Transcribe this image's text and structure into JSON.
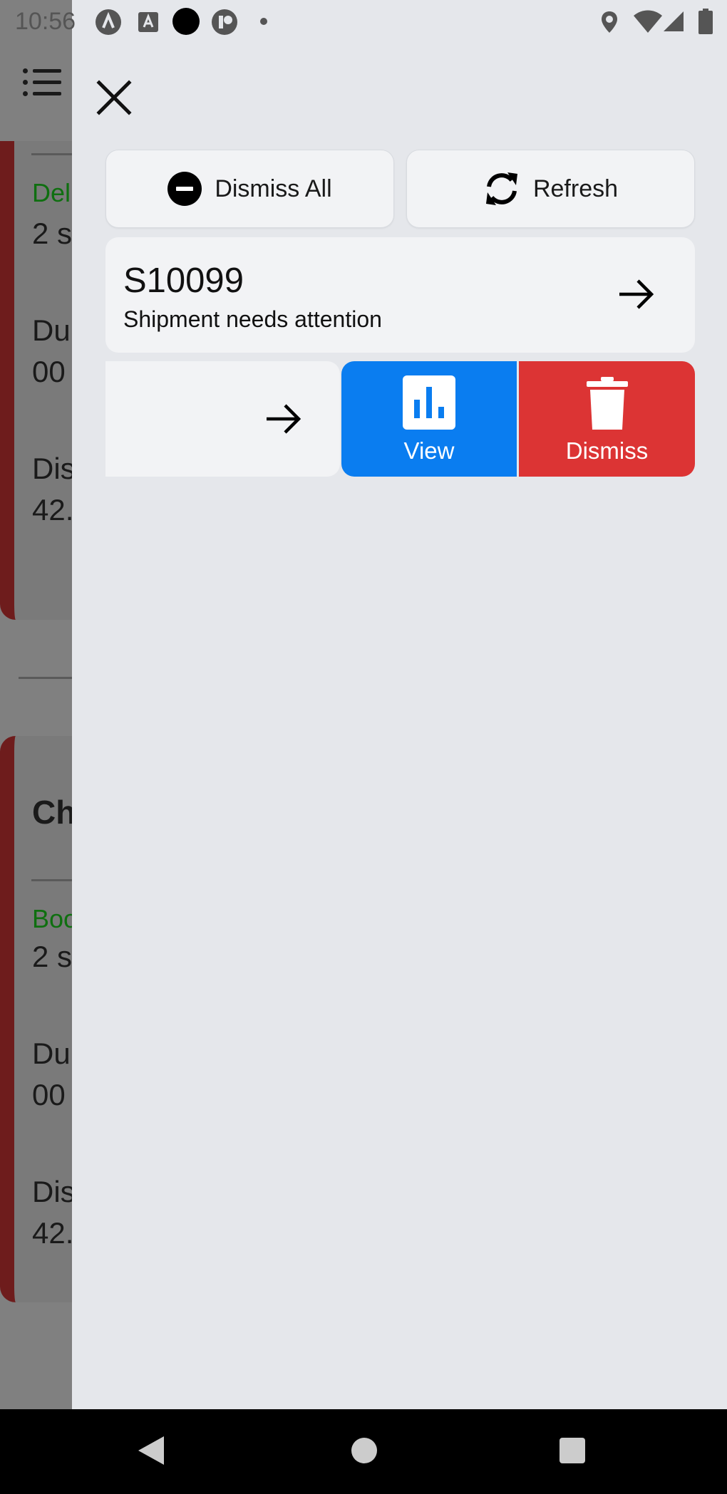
{
  "status_bar": {
    "time": "10:56"
  },
  "background": {
    "card1": {
      "status_label": "Deli",
      "line1": "2 s",
      "duration_label": "Dur",
      "duration_value": "00",
      "distance_label": "Dis",
      "distance_value": "42."
    },
    "card2": {
      "title": "Ch",
      "status_label": "Boo",
      "line1": "2 s",
      "duration_label": "Dur",
      "duration_value": "00",
      "distance_label": "Dis",
      "distance_value": "42."
    }
  },
  "drawer": {
    "dismiss_all_label": "Dismiss All",
    "refresh_label": "Refresh",
    "notification": {
      "title": "S10099",
      "subtitle": "Shipment needs attention"
    },
    "swipe_actions": {
      "view_label": "View",
      "dismiss_label": "Dismiss"
    }
  },
  "colors": {
    "view_action": "#0a7df0",
    "dismiss_action": "#dc3434",
    "drawer_background": "#e5e7eb",
    "card_accent": "#6e1c1c",
    "status_green": "#0f6f10"
  },
  "icons": {
    "close": "close-icon",
    "dismiss_all": "minus-circle-icon",
    "refresh": "refresh-icon",
    "arrow": "arrow-right-icon",
    "view": "bar-chart-icon",
    "dismiss": "trash-icon"
  }
}
